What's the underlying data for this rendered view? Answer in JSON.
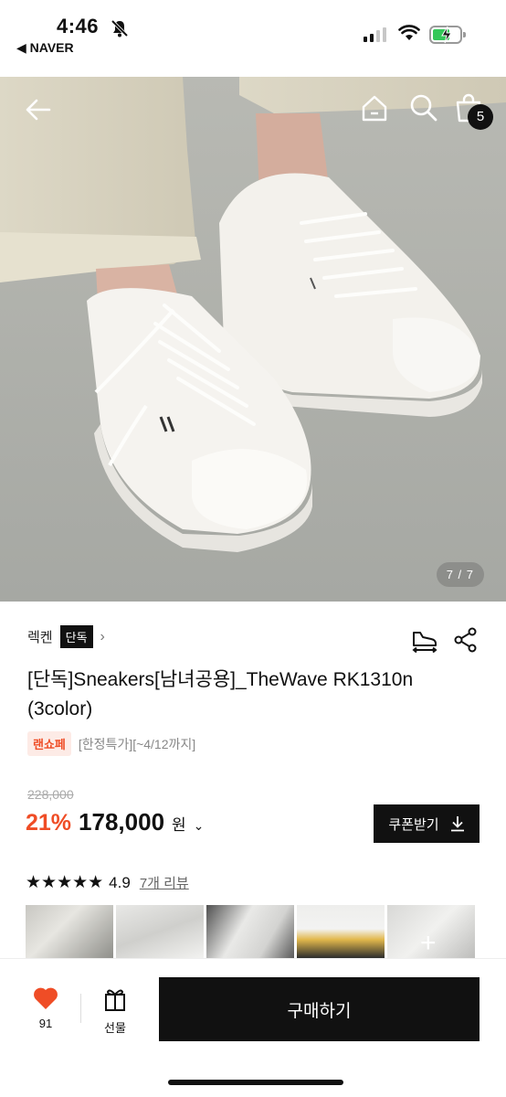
{
  "status_bar": {
    "time": "4:46",
    "back_app": "◀ NAVER"
  },
  "top_nav": {
    "cart_count": "5"
  },
  "gallery": {
    "counter": "7 / 7"
  },
  "product": {
    "brand": "렉켄",
    "brand_tag": "단독",
    "title": "[단독]Sneakers[남녀공용]_TheWave RK1310n (3color)",
    "event_tag": "랜쇼페",
    "event_text": "[한정특가][~4/12까지]",
    "original_price": "228,000",
    "discount": "21%",
    "price": "178,000",
    "currency": "원",
    "coupon_label": "쿠폰받기",
    "stars": "★★★★★",
    "rating": "4.9",
    "review_link": "7개 리뷰"
  },
  "bottom_bar": {
    "like_count": "91",
    "gift_label": "선물",
    "buy_label": "구매하기"
  },
  "colors": {
    "accent": "#ef4d26",
    "primary": "#111111"
  }
}
